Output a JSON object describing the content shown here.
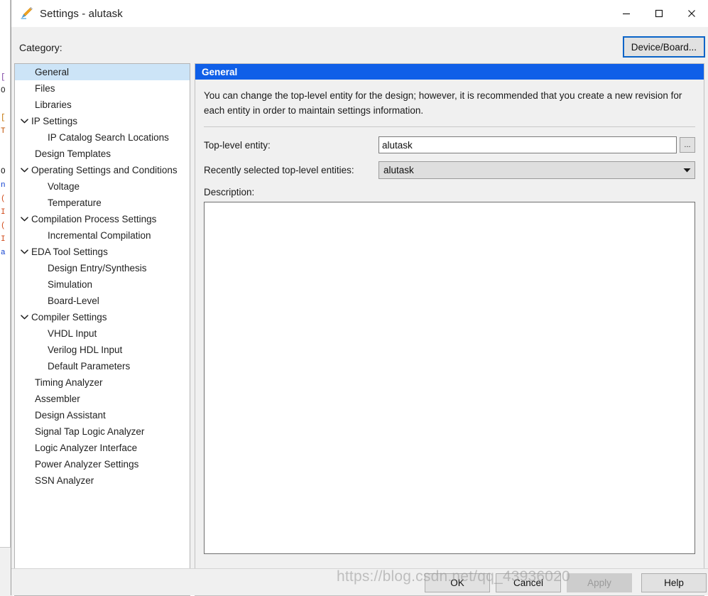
{
  "window": {
    "title": "Settings - alutask",
    "icon": "pencil-icon",
    "controls": {
      "minimize": "—",
      "maximize": "☐",
      "close": "✕"
    }
  },
  "toolbar": {
    "category_label": "Category:",
    "device_board_label": "Device/Board..."
  },
  "tree": {
    "items": [
      {
        "label": "General",
        "level": 0,
        "expandable": false,
        "selected": true
      },
      {
        "label": "Files",
        "level": 0,
        "expandable": false,
        "selected": false
      },
      {
        "label": "Libraries",
        "level": 0,
        "expandable": false,
        "selected": false
      },
      {
        "label": "IP Settings",
        "level": 0,
        "expandable": true,
        "selected": false
      },
      {
        "label": "IP Catalog Search Locations",
        "level": 1,
        "expandable": false,
        "selected": false
      },
      {
        "label": "Design Templates",
        "level": 0,
        "expandable": false,
        "selected": false
      },
      {
        "label": "Operating Settings and Conditions",
        "level": 0,
        "expandable": true,
        "selected": false
      },
      {
        "label": "Voltage",
        "level": 1,
        "expandable": false,
        "selected": false
      },
      {
        "label": "Temperature",
        "level": 1,
        "expandable": false,
        "selected": false
      },
      {
        "label": "Compilation Process Settings",
        "level": 0,
        "expandable": true,
        "selected": false
      },
      {
        "label": "Incremental Compilation",
        "level": 1,
        "expandable": false,
        "selected": false
      },
      {
        "label": "EDA Tool Settings",
        "level": 0,
        "expandable": true,
        "selected": false
      },
      {
        "label": "Design Entry/Synthesis",
        "level": 1,
        "expandable": false,
        "selected": false
      },
      {
        "label": "Simulation",
        "level": 1,
        "expandable": false,
        "selected": false
      },
      {
        "label": "Board-Level",
        "level": 1,
        "expandable": false,
        "selected": false
      },
      {
        "label": "Compiler Settings",
        "level": 0,
        "expandable": true,
        "selected": false
      },
      {
        "label": "VHDL Input",
        "level": 1,
        "expandable": false,
        "selected": false
      },
      {
        "label": "Verilog HDL Input",
        "level": 1,
        "expandable": false,
        "selected": false
      },
      {
        "label": "Default Parameters",
        "level": 1,
        "expandable": false,
        "selected": false
      },
      {
        "label": "Timing Analyzer",
        "level": 0,
        "expandable": false,
        "selected": false
      },
      {
        "label": "Assembler",
        "level": 0,
        "expandable": false,
        "selected": false
      },
      {
        "label": "Design Assistant",
        "level": 0,
        "expandable": false,
        "selected": false
      },
      {
        "label": "Signal Tap Logic Analyzer",
        "level": 0,
        "expandable": false,
        "selected": false
      },
      {
        "label": "Logic Analyzer Interface",
        "level": 0,
        "expandable": false,
        "selected": false
      },
      {
        "label": "Power Analyzer Settings",
        "level": 0,
        "expandable": false,
        "selected": false
      },
      {
        "label": "SSN Analyzer",
        "level": 0,
        "expandable": false,
        "selected": false
      }
    ],
    "scrollbar": {
      "left_arrow": "‹",
      "right_arrow": "›"
    }
  },
  "panel": {
    "header": "General",
    "description_paragraph": "You can change the top-level entity for the design; however, it is recommended that you create a new revision for each entity in order to maintain settings information.",
    "top_level_entity": {
      "label": "Top-level entity:",
      "value": "alutask",
      "browse_label": "..."
    },
    "recently_selected": {
      "label": "Recently selected top-level entities:",
      "value": "alutask",
      "options": [
        "alutask"
      ]
    },
    "description": {
      "label": "Description:",
      "value": ""
    }
  },
  "buttons": {
    "ok": "OK",
    "cancel": "Cancel",
    "apply": "Apply",
    "help": "Help"
  },
  "watermark": "https://blog.csdn.net/qq_43936020",
  "background_code": {
    "lines": [
      "[",
      "O",
      "",
      "T",
      "",
      "O",
      "n",
      "(",
      "I",
      "(",
      "I",
      "a"
    ]
  },
  "colors": {
    "accent_blue": "#0f5fe8",
    "selection_blue": "#cce4f7",
    "focus_border": "#0a64c8",
    "dialog_bg": "#f0f0f0"
  }
}
